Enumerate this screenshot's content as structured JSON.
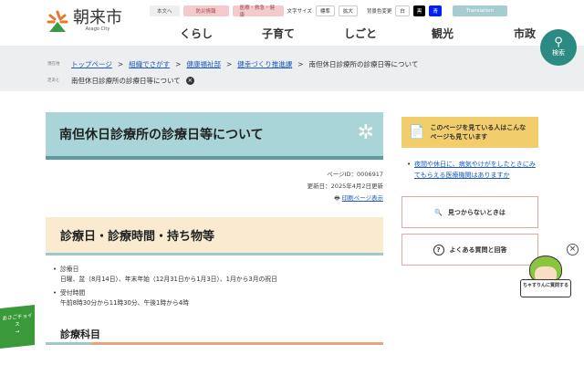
{
  "header": {
    "logo_name": "朝来市",
    "logo_sub": "Asago City",
    "util": {
      "skip": "本文へ",
      "disaster": "防災情報",
      "medical": "医療・救急・健康",
      "font_size_label": "文字サイズ",
      "font_standard": "標準",
      "font_large": "拡大",
      "bg_label": "背景色変更",
      "bg_white": "白",
      "bg_black": "黒",
      "bg_blue": "青",
      "translation": "Translation"
    },
    "nav": [
      "くらし",
      "子育て",
      "しごと",
      "観光",
      "市政"
    ],
    "search_label": "検索"
  },
  "breadcrumb": {
    "current_label": "現在地",
    "items": [
      "トップページ",
      "組織でさがす",
      "健康福祉部",
      "健幸づくり推進課"
    ],
    "current": "南但休日診療所の診療日等について",
    "history_label": "足あと",
    "history_item": "南但休日診療所の診療日等について"
  },
  "main": {
    "title": "南但休日診療所の診療日等について",
    "page_id": "ページID：0006917",
    "updated": "更新日：2025年4月2日更新",
    "print": "印刷ページ表示",
    "section1": "診療日・診療時間・持ち物等",
    "items": [
      {
        "label": "診療日",
        "text": "日曜、盆（8月14日）、年末年始（12月31日から1月3日）、1月から3月の祝日"
      },
      {
        "label": "受付時間",
        "text": "午前8時30分から11時30分、午後1時から4時"
      }
    ],
    "section2": "診療科目"
  },
  "sidebar": {
    "recommend_title": "このページを見ている人はこんなページも見ています",
    "links": [
      "夜間や休日に、病気やけがをしたときにみてもらえる医療機関はありますか"
    ],
    "not_found": "見つからないときは",
    "faq": "よくある質問と回答"
  },
  "chatbot": {
    "label": "ちゃすりんに質問する"
  },
  "asago_choice": {
    "label": "あさごチョイス",
    "arrow": "→"
  }
}
